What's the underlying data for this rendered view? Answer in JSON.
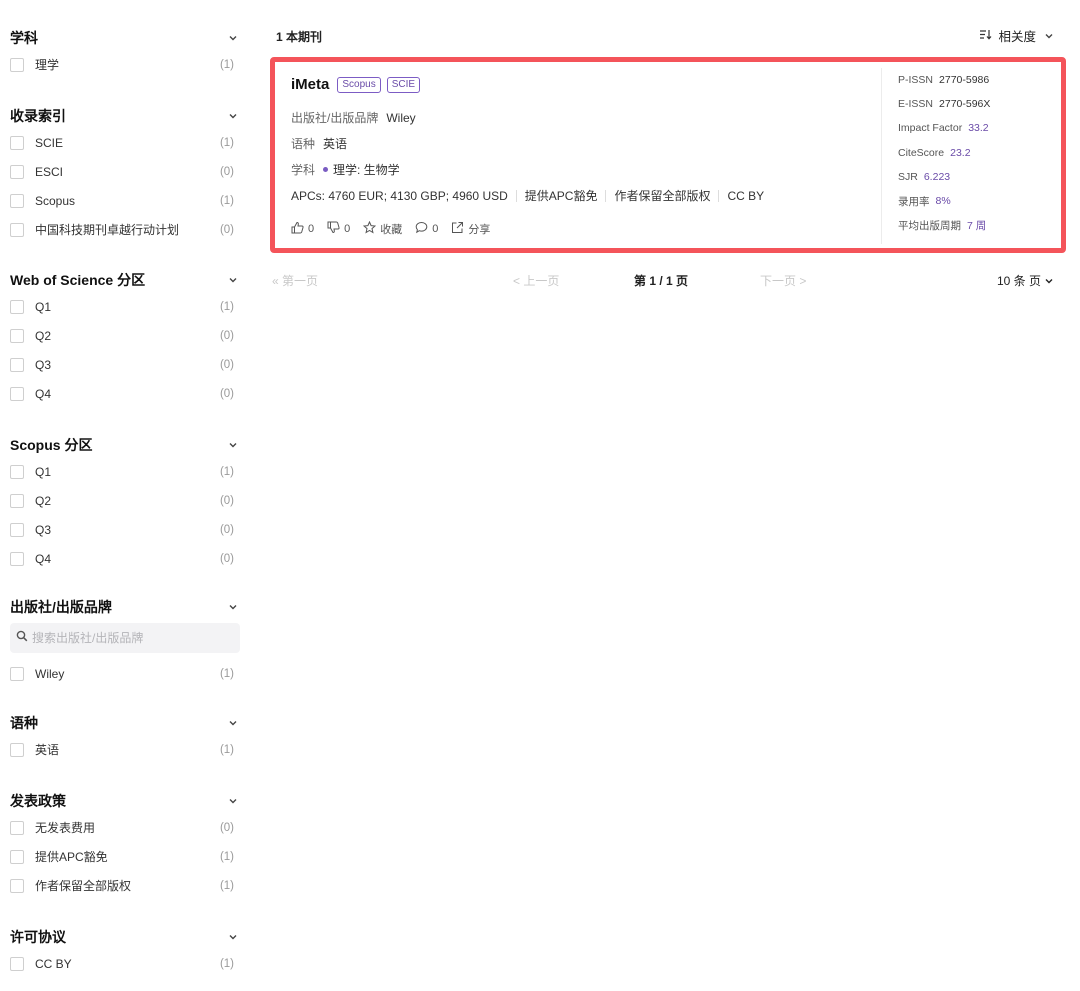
{
  "sidebar": {
    "groups": [
      {
        "title": "学科",
        "options": [
          {
            "label": "理学",
            "count": "(1)"
          }
        ]
      },
      {
        "title": "收录索引",
        "options": [
          {
            "label": "SCIE",
            "count": "(1)"
          },
          {
            "label": "ESCI",
            "count": "(0)"
          },
          {
            "label": "Scopus",
            "count": "(1)"
          },
          {
            "label": "中国科技期刊卓越行动计划",
            "count": "(0)"
          }
        ]
      },
      {
        "title": "Web of Science 分区",
        "options": [
          {
            "label": "Q1",
            "count": "(1)"
          },
          {
            "label": "Q2",
            "count": "(0)"
          },
          {
            "label": "Q3",
            "count": "(0)"
          },
          {
            "label": "Q4",
            "count": "(0)"
          }
        ]
      },
      {
        "title": "Scopus 分区",
        "options": [
          {
            "label": "Q1",
            "count": "(1)"
          },
          {
            "label": "Q2",
            "count": "(0)"
          },
          {
            "label": "Q3",
            "count": "(0)"
          },
          {
            "label": "Q4",
            "count": "(0)"
          }
        ]
      },
      {
        "title": "出版社/出版品牌",
        "search_placeholder": "搜索出版社/出版品牌",
        "options": [
          {
            "label": "Wiley",
            "count": "(1)"
          }
        ]
      },
      {
        "title": "语种",
        "options": [
          {
            "label": "英语",
            "count": "(1)"
          }
        ]
      },
      {
        "title": "发表政策",
        "options": [
          {
            "label": "无发表费用",
            "count": "(0)"
          },
          {
            "label": "提供APC豁免",
            "count": "(1)"
          },
          {
            "label": "作者保留全部版权",
            "count": "(1)"
          }
        ]
      },
      {
        "title": "许可协议",
        "options": [
          {
            "label": "CC BY",
            "count": "(1)"
          }
        ]
      }
    ]
  },
  "main": {
    "results_count": "1 本期刊",
    "sort_label": "相关度",
    "journal": {
      "title": "iMeta",
      "tags": [
        "Scopus",
        "SCIE"
      ],
      "publisher_label": "出版社/出版品牌",
      "publisher": "Wiley",
      "language_label": "语种",
      "language": "英语",
      "subject_label": "学科",
      "subject": "理学: 生物学",
      "apcs": "APCs: 4760 EUR; 4130 GBP; 4960 USD",
      "policies": [
        "提供APC豁免",
        "作者保留全部版权",
        "CC BY"
      ],
      "actions": {
        "likes": "0",
        "dislikes": "0",
        "favorite": "收藏",
        "comments": "0",
        "share": "分享"
      },
      "metrics": [
        {
          "label": "P-ISSN",
          "value": "2770-5986",
          "accent": false
        },
        {
          "label": "E-ISSN",
          "value": "2770-596X",
          "accent": false
        },
        {
          "label": "Impact Factor",
          "value": "33.2",
          "accent": true
        },
        {
          "label": "CiteScore",
          "value": "23.2",
          "accent": true
        },
        {
          "label": "SJR",
          "value": "6.223",
          "accent": true
        },
        {
          "label": "录用率",
          "value": "8%",
          "accent": true
        },
        {
          "label": "平均出版周期",
          "value": "7 周",
          "accent": true
        }
      ]
    },
    "pagination": {
      "first": "« 第一页",
      "prev": "< 上一页",
      "current": "第 1 / 1 页",
      "next": "下一页 >",
      "page_size": "10 条 页"
    }
  },
  "colors": {
    "accent": "#6a4ba8",
    "highlight_border": "#f4545a"
  }
}
